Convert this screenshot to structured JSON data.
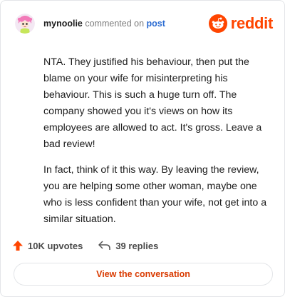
{
  "comment": {
    "username": "mynoolie",
    "action_text": "commented on",
    "target_link": "post",
    "body": [
      "NTA. They justified his behaviour, then put the blame on your wife for misinterpreting his behaviour. This is such a huge turn off. The company showed you it's views on how its employees are allowed to act. It's gross. Leave a bad review!",
      "In fact, think of it this way. By leaving the review, you are helping some other woman, maybe one who is less confident than your wife, not get into a similar situation."
    ]
  },
  "brand": {
    "logo_text": "reddit",
    "color": "#ff4500"
  },
  "stats": {
    "upvotes": "10K upvotes",
    "replies": "39 replies"
  },
  "cta": {
    "label": "View the conversation"
  },
  "icons": {
    "avatar": "avatar-illustration",
    "logo": "reddit-snoo-icon",
    "upvote": "upvote-arrow-icon",
    "reply": "reply-arrow-icon"
  }
}
